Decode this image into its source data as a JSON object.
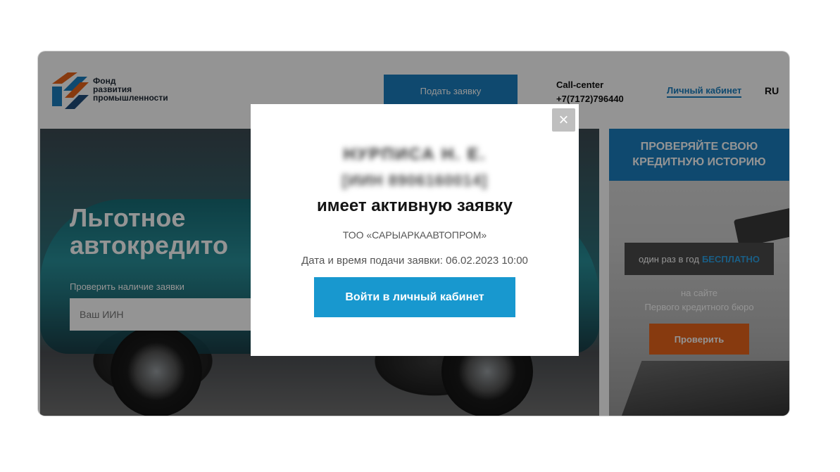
{
  "header": {
    "logo_lines": [
      "Фонд",
      "развития",
      "промышленности"
    ],
    "apply_label": "Подать заявку",
    "callcenter_label": "Call-center",
    "callcenter_phone": "+7(7172)796440",
    "cabinet_link": "Личный кабинет",
    "language": "RU"
  },
  "hero": {
    "title_line1": "Льготное",
    "title_line2": "автокредито",
    "check_label": "Проверить наличие заявки",
    "iin_placeholder": "Ваш ИИН"
  },
  "side_banner": {
    "title_line1": "ПРОВЕРЯЙТЕ СВОЮ",
    "title_line2": "КРЕДИТНУЮ ИСТОРИЮ",
    "pill_text": "один раз в год",
    "pill_free": "БЕСПЛАТНО",
    "site_line1": "на сайте",
    "site_line2": "Первого кредитного бюро",
    "check_button": "Проверить"
  },
  "modal": {
    "close_glyph": "×",
    "name_redacted": "НУРПИСА Н. Е.",
    "iin_redacted": "[ИИН 8906160014]",
    "status": "имеет активную заявку",
    "company": "ТОО «САРЫАРКААВТОПРОМ»",
    "date_label": "Дата и время подачи заявки:",
    "date_value": "06.02.2023 10:00",
    "login_button": "Войти в личный кабинет"
  },
  "colors": {
    "brand_blue": "#1a7fbf",
    "modal_button": "#1898cf",
    "orange": "#e8651a"
  }
}
